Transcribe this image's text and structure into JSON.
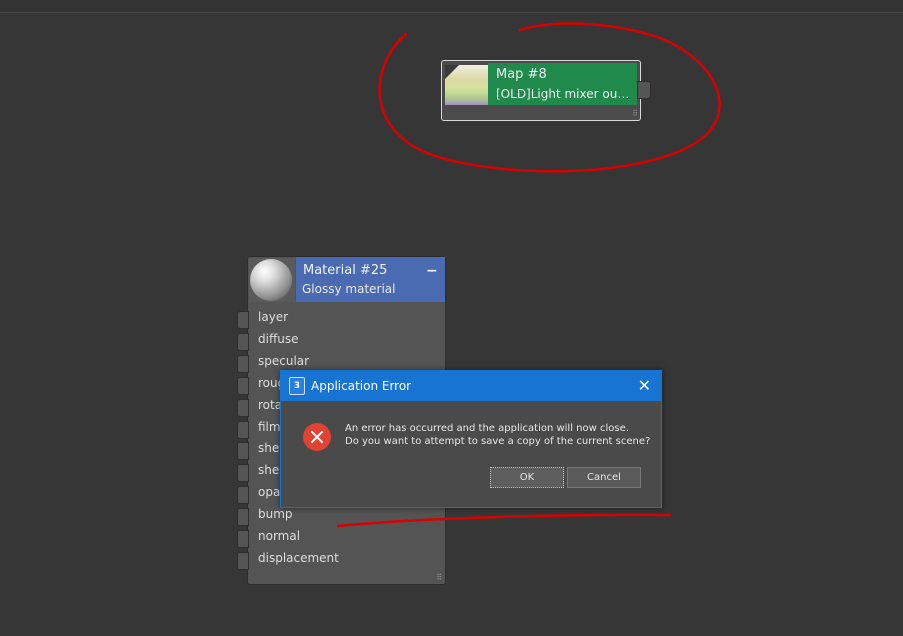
{
  "map_node": {
    "title": "Map #8",
    "subtitle": "[OLD]Light mixer outp…"
  },
  "material_node": {
    "title": "Material #25",
    "subtitle": "Glossy material",
    "collapse_symbol": "−",
    "slots": [
      "layer",
      "diffuse",
      "specular",
      "rough",
      "rota",
      "film",
      "shee",
      "shee",
      "opa",
      "bump",
      "normal",
      "displacement"
    ]
  },
  "dialog": {
    "app_icon_text": "3",
    "title": "Application Error",
    "close_symbol": "✕",
    "message_line1": "An error has occurred and the application will now close.",
    "message_line2": "Do you want to attempt to save a copy of the current scene?",
    "ok_label": "OK",
    "cancel_label": "Cancel"
  },
  "colors": {
    "annotation_red": "#d90000",
    "map_header": "#1f8a4c",
    "material_header": "#4a6ab1",
    "dialog_titlebar": "#1874d2"
  }
}
